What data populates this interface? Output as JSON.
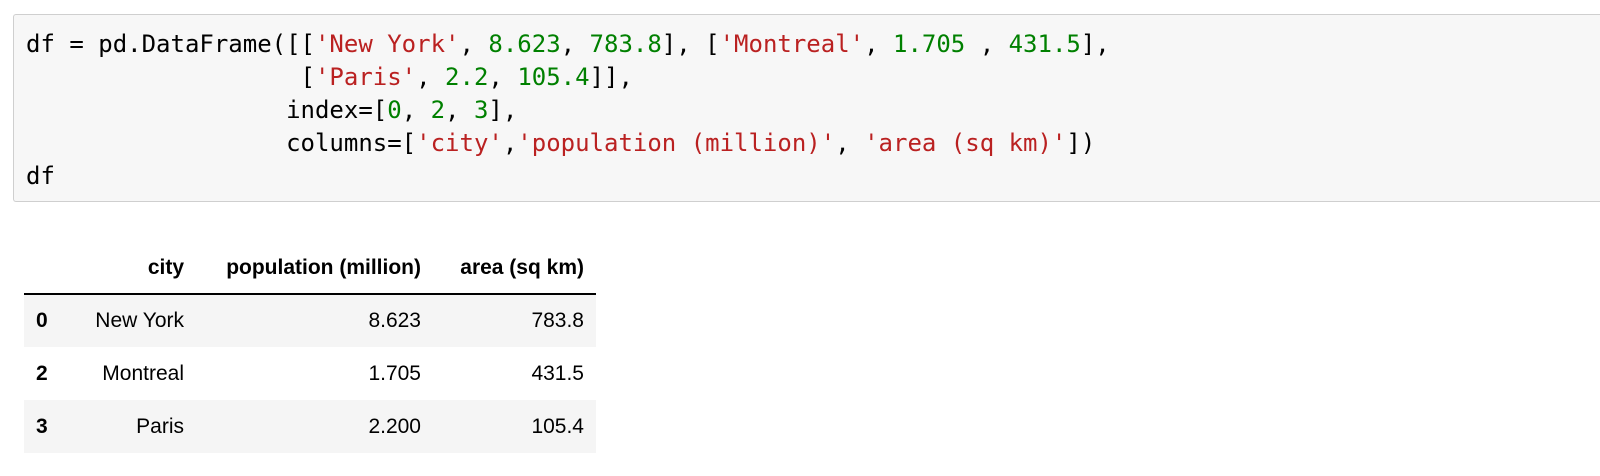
{
  "code_cell": {
    "lines": [
      [
        {
          "t": "df = pd.DataFrame([[",
          "c": "p"
        },
        {
          "t": "'New York'",
          "c": "s"
        },
        {
          "t": ", ",
          "c": "p"
        },
        {
          "t": "8.623",
          "c": "n"
        },
        {
          "t": ", ",
          "c": "p"
        },
        {
          "t": "783.8",
          "c": "n"
        },
        {
          "t": "], [",
          "c": "p"
        },
        {
          "t": "'Montreal'",
          "c": "s"
        },
        {
          "t": ", ",
          "c": "p"
        },
        {
          "t": "1.705",
          "c": "n"
        },
        {
          "t": " , ",
          "c": "p"
        },
        {
          "t": "431.5",
          "c": "n"
        },
        {
          "t": "],",
          "c": "p"
        }
      ],
      [
        {
          "t": "                   [",
          "c": "p"
        },
        {
          "t": "'Paris'",
          "c": "s"
        },
        {
          "t": ", ",
          "c": "p"
        },
        {
          "t": "2.2",
          "c": "n"
        },
        {
          "t": ", ",
          "c": "p"
        },
        {
          "t": "105.4",
          "c": "n"
        },
        {
          "t": "]],",
          "c": "p"
        }
      ],
      [
        {
          "t": "                  index=[",
          "c": "p"
        },
        {
          "t": "0",
          "c": "n"
        },
        {
          "t": ", ",
          "c": "p"
        },
        {
          "t": "2",
          "c": "n"
        },
        {
          "t": ", ",
          "c": "p"
        },
        {
          "t": "3",
          "c": "n"
        },
        {
          "t": "],",
          "c": "p"
        }
      ],
      [
        {
          "t": "                  columns=[",
          "c": "p"
        },
        {
          "t": "'city'",
          "c": "s"
        },
        {
          "t": ",",
          "c": "p"
        },
        {
          "t": "'population (million)'",
          "c": "s"
        },
        {
          "t": ", ",
          "c": "p"
        },
        {
          "t": "'area (sq km)'",
          "c": "s"
        },
        {
          "t": "])",
          "c": "p"
        }
      ],
      [
        {
          "t": "df",
          "c": "p"
        }
      ]
    ]
  },
  "output_table": {
    "index_header": "",
    "columns": [
      "city",
      "population (million)",
      "area (sq km)"
    ],
    "rows": [
      {
        "index": "0",
        "city": "New York",
        "population": "8.623",
        "area": "783.8"
      },
      {
        "index": "2",
        "city": "Montreal",
        "population": "1.705",
        "area": "431.5"
      },
      {
        "index": "3",
        "city": "Paris",
        "population": "2.200",
        "area": "105.4"
      }
    ]
  },
  "colors": {
    "string": "#ba2121",
    "number": "#008000",
    "cell_background": "#f7f7f7",
    "cell_border": "#cfcfcf",
    "table_stripe": "#f5f5f5"
  }
}
